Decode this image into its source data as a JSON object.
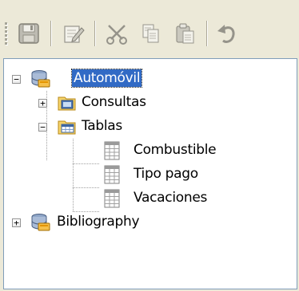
{
  "toolbar": {
    "buttons": [
      {
        "name": "save-icon"
      },
      {
        "name": "edit-icon"
      },
      {
        "name": "cut-icon"
      },
      {
        "name": "copy-icon"
      },
      {
        "name": "paste-icon"
      },
      {
        "name": "undo-icon"
      }
    ]
  },
  "tree": {
    "automovil": "Automóvil",
    "consultas": "Consultas",
    "tablas": "Tablas",
    "combustible": "Combustible",
    "tipo_pago": "Tipo pago",
    "vacaciones": "Vacaciones",
    "bibliography": "Bibliography"
  },
  "colors": {
    "selection": "#316ac5",
    "background": "#ece9d8"
  }
}
